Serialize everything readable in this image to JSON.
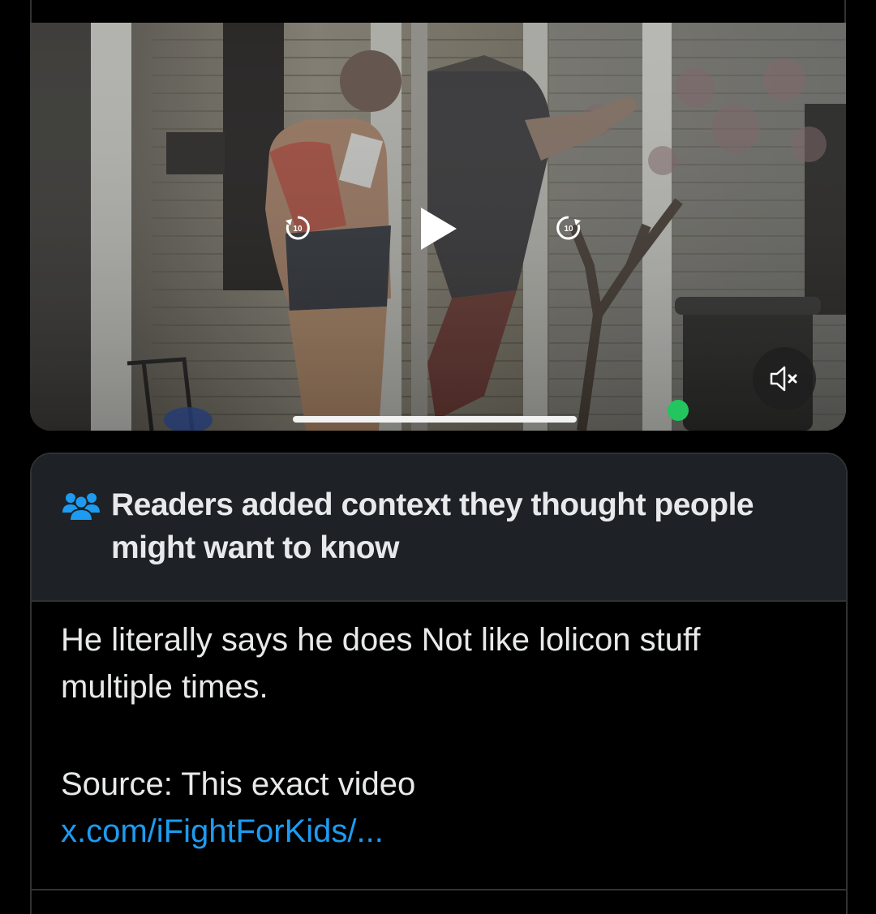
{
  "video": {
    "skip_back_label": "10",
    "skip_forward_label": "10",
    "play_icon": "play-icon",
    "mute_icon": "speaker-muted-icon",
    "progress": 0.0
  },
  "community_note": {
    "icon": "people-group-icon",
    "title": "Readers added context they thought people might want to know",
    "body_line1": "He literally says he does Not like lolicon stuff multiple times.",
    "source_text": "Source: This exact video",
    "link_text": "x.com/iFightForKids/..."
  },
  "colors": {
    "background": "#000000",
    "note_header_bg": "#1e2226",
    "border": "#2f3336",
    "text": "#e7e9ea",
    "link": "#1d9bf0",
    "note_icon": "#1d9bf0"
  }
}
